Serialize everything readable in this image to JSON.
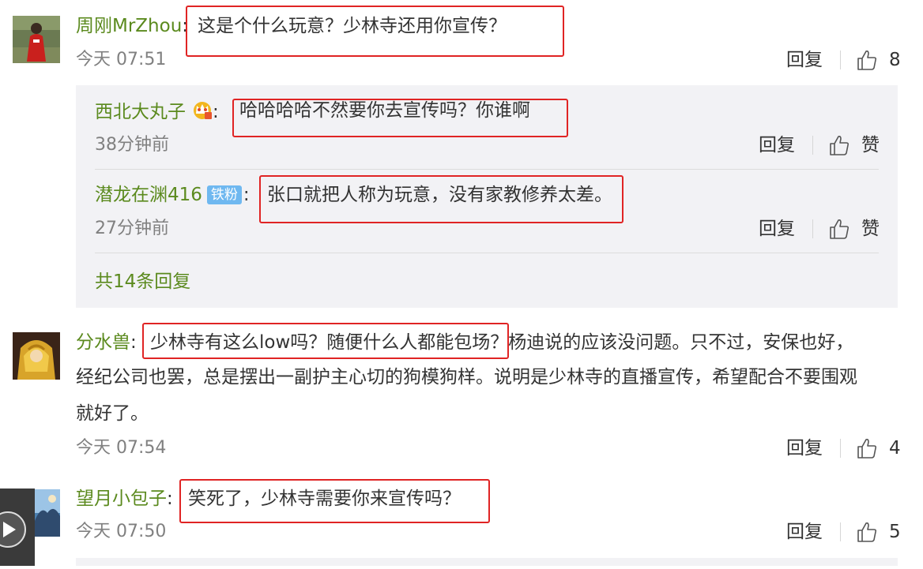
{
  "comments": [
    {
      "user": "周刚MrZhou",
      "colon": ":",
      "text": "这是个什么玩意？少林寺还用你宣传？",
      "time": "今天 07:51",
      "reply_label": "回复",
      "likes": "8",
      "replies": [
        {
          "user": "西北大丸子",
          "colon": ":",
          "text": "哈哈哈哈不然要你去宣传吗？你谁啊",
          "time": "38分钟前",
          "reply_label": "回复",
          "like_label": "赞"
        },
        {
          "user": "潜龙在渊416",
          "badge": "铁粉",
          "colon": ":",
          "text": "张口就把人称为玩意，没有家教修养太差。",
          "time": "27分钟前",
          "reply_label": "回复",
          "like_label": "赞"
        }
      ],
      "more_replies": "共14条回复"
    },
    {
      "user": "分水兽",
      "colon": ":",
      "text_highlight": "少林寺有这么low吗？随便什么人都能包场",
      "text_rest_line1": "？杨迪说的应该没问题。只不过，安保也好，",
      "text_line2": "经纪公司也罢，总是摆出一副护主心切的狗模狗样。说明是少林寺的直播宣传，希望配合不要围观",
      "text_line3": "就好了。",
      "time": "今天 07:54",
      "reply_label": "回复",
      "likes": "4"
    },
    {
      "user": "望月小包子",
      "colon": ":",
      "text": "笑死了，少林寺需要你来宣传吗？",
      "time": "今天 07:50",
      "reply_label": "回复",
      "likes": "5"
    }
  ],
  "icons": {
    "like": "thumbs-up-icon",
    "crown": "crown-icon",
    "video_play": "play-icon"
  },
  "colors": {
    "username": "#5b8a1e",
    "highlight_box": "#e02424",
    "subpanel": "#f2f2f5"
  }
}
